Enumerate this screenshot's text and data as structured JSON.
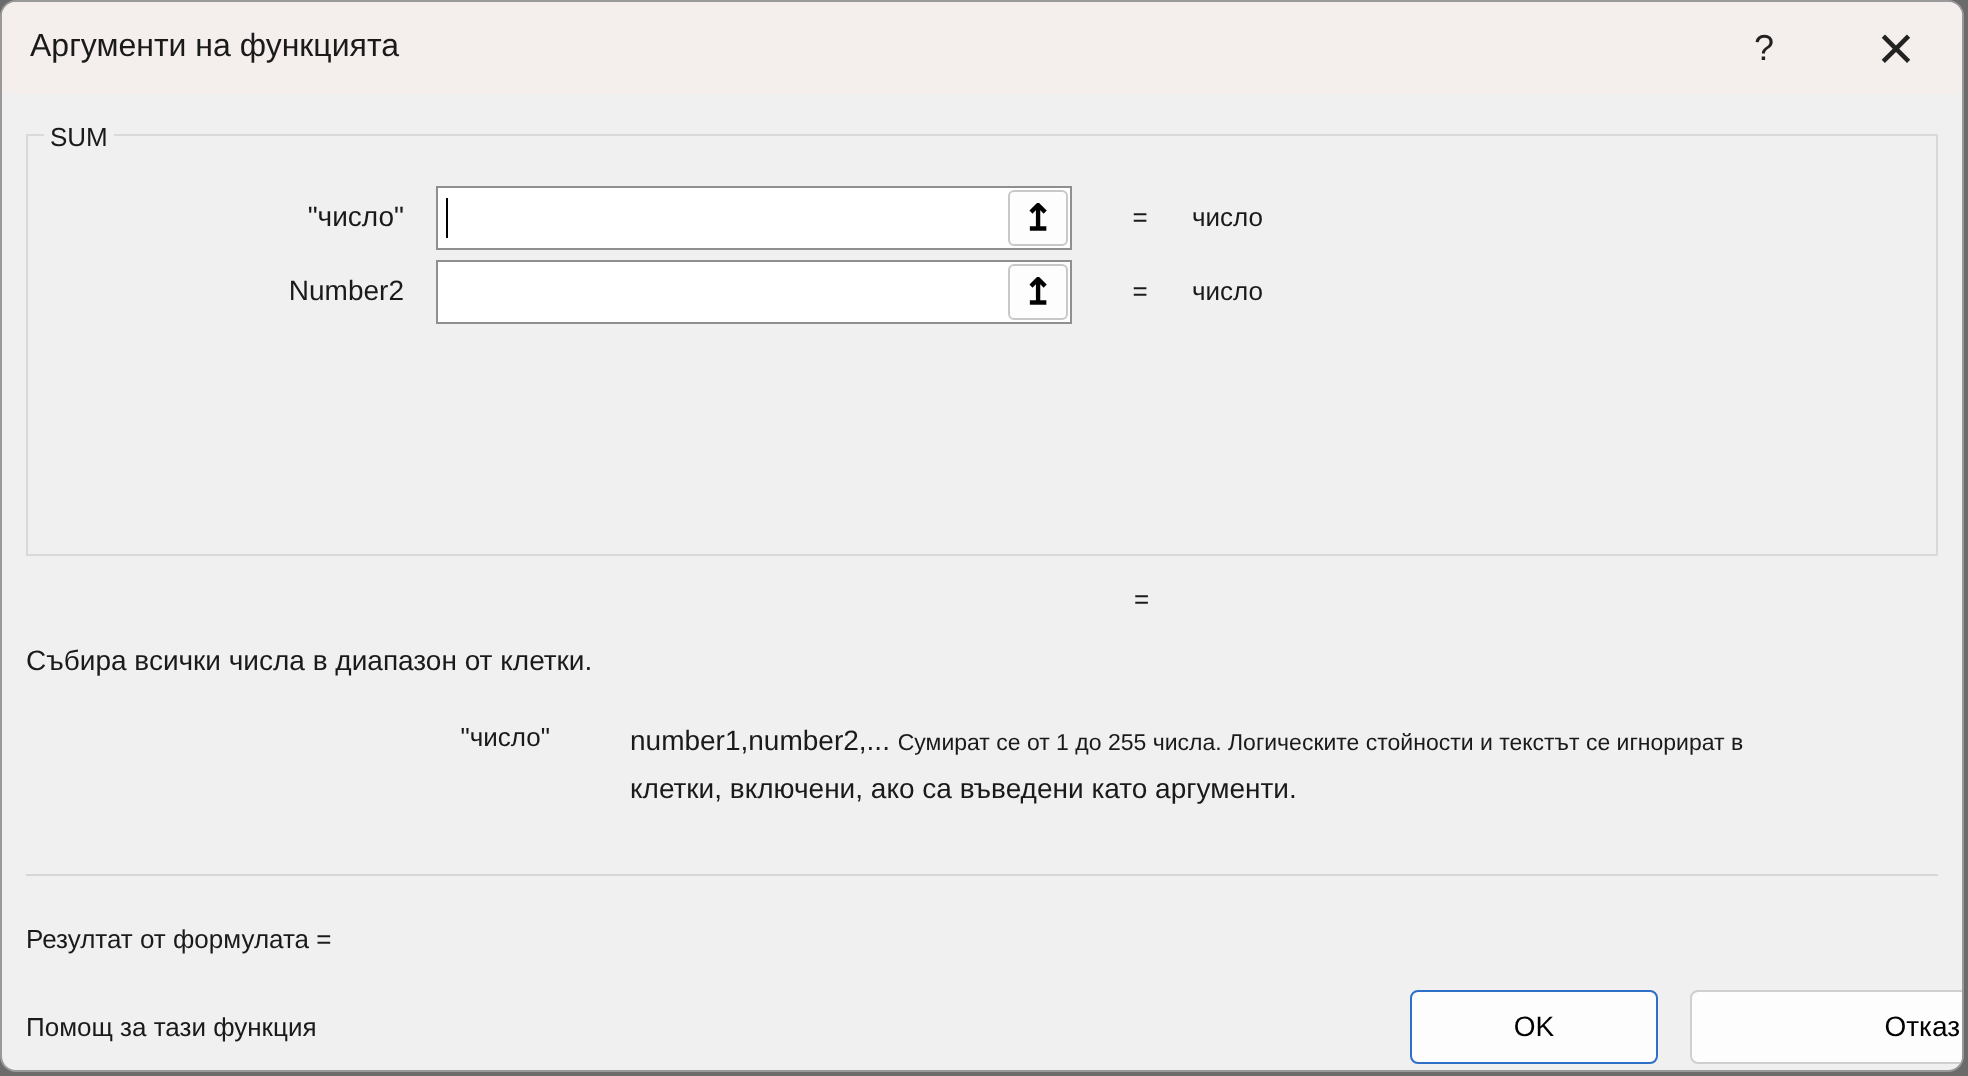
{
  "window": {
    "title": "Аргументи на функцията",
    "help": "?",
    "close": "×"
  },
  "group": {
    "title": "SUM",
    "args": [
      {
        "label": "\"число\"",
        "focused": true,
        "button": "↥",
        "eq": "=",
        "result": "число"
      },
      {
        "label": "Number2",
        "focused": false,
        "button": "↥",
        "eq": "=",
        "result": "число"
      }
    ]
  },
  "total_eq": "=",
  "summary": "Събира всички числа в диапазон от клетки.",
  "arg_help": {
    "label": "\"число\"",
    "syntax": "number1,number2,...",
    "text_small": "Сумират се от 1 до 255 числа. Логическите стойности и текстът се игнорират в",
    "text_large": "клетки, включени, ако са въведени като аргументи."
  },
  "formula_result": "Резултат от формулата =",
  "help_link": "Помощ за тази функция",
  "buttons": [
    {
      "label": "OK",
      "default": true
    },
    {
      "label": "Отказ",
      "default": false
    }
  ]
}
